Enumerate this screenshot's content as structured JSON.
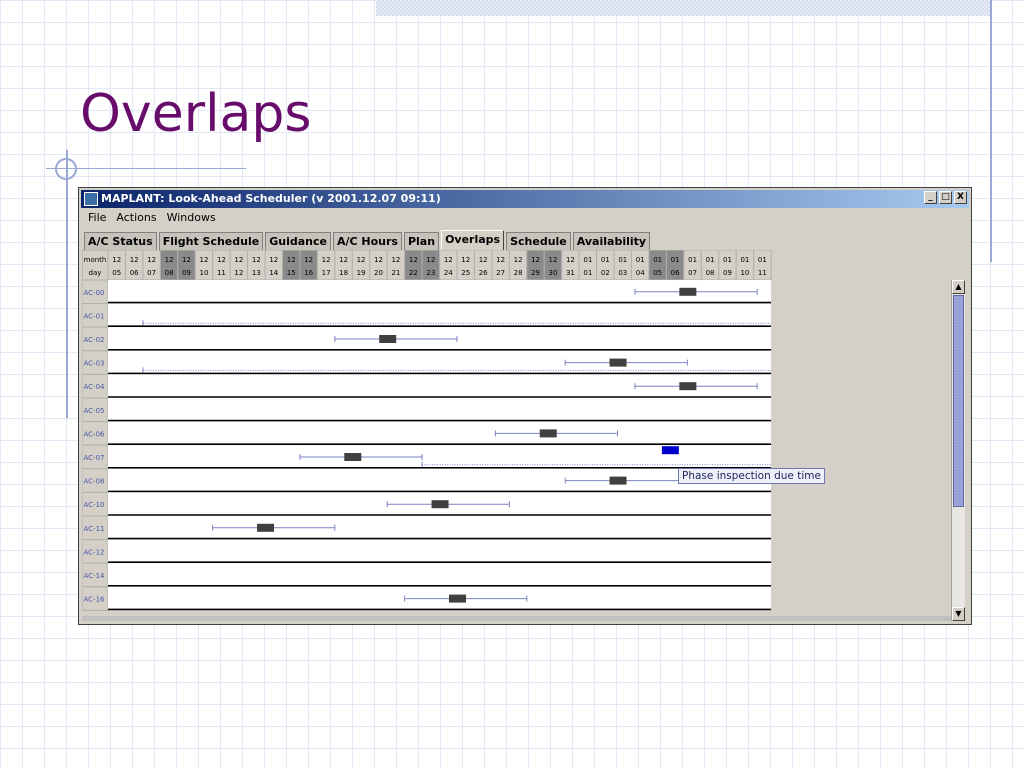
{
  "slide": {
    "title": "Overlaps"
  },
  "window": {
    "title": "MAPLANT: Look-Ahead Scheduler  (v 2001.12.07 09:11)",
    "controls": [
      "_",
      "□",
      "X"
    ]
  },
  "menu": [
    "File",
    "Actions",
    "Windows"
  ],
  "tabs": [
    {
      "label": "A/C Status",
      "active": false
    },
    {
      "label": "Flight Schedule",
      "active": false
    },
    {
      "label": "Guidance",
      "active": false
    },
    {
      "label": "A/C Hours",
      "active": false
    },
    {
      "label": "Plan",
      "active": false
    },
    {
      "label": "Overlaps",
      "active": true
    },
    {
      "label": "Schedule",
      "active": false
    },
    {
      "label": "Availability",
      "active": false
    }
  ],
  "grid": {
    "month_label": "month",
    "day_label": "day",
    "dates": [
      {
        "m": "12",
        "d": "05",
        "w": false
      },
      {
        "m": "12",
        "d": "06",
        "w": false
      },
      {
        "m": "12",
        "d": "07",
        "w": false
      },
      {
        "m": "12",
        "d": "08",
        "w": true
      },
      {
        "m": "12",
        "d": "09",
        "w": true
      },
      {
        "m": "12",
        "d": "10",
        "w": false
      },
      {
        "m": "12",
        "d": "11",
        "w": false
      },
      {
        "m": "12",
        "d": "12",
        "w": false
      },
      {
        "m": "12",
        "d": "13",
        "w": false
      },
      {
        "m": "12",
        "d": "14",
        "w": false
      },
      {
        "m": "12",
        "d": "15",
        "w": true
      },
      {
        "m": "12",
        "d": "16",
        "w": true
      },
      {
        "m": "12",
        "d": "17",
        "w": false
      },
      {
        "m": "12",
        "d": "18",
        "w": false
      },
      {
        "m": "12",
        "d": "19",
        "w": false
      },
      {
        "m": "12",
        "d": "20",
        "w": false
      },
      {
        "m": "12",
        "d": "21",
        "w": false
      },
      {
        "m": "12",
        "d": "22",
        "w": true
      },
      {
        "m": "12",
        "d": "23",
        "w": true
      },
      {
        "m": "12",
        "d": "24",
        "w": false
      },
      {
        "m": "12",
        "d": "25",
        "w": false
      },
      {
        "m": "12",
        "d": "26",
        "w": false
      },
      {
        "m": "12",
        "d": "27",
        "w": false
      },
      {
        "m": "12",
        "d": "28",
        "w": false
      },
      {
        "m": "12",
        "d": "29",
        "w": true
      },
      {
        "m": "12",
        "d": "30",
        "w": true
      },
      {
        "m": "12",
        "d": "31",
        "w": false
      },
      {
        "m": "01",
        "d": "01",
        "w": false
      },
      {
        "m": "01",
        "d": "02",
        "w": false
      },
      {
        "m": "01",
        "d": "03",
        "w": false
      },
      {
        "m": "01",
        "d": "04",
        "w": false
      },
      {
        "m": "01",
        "d": "05",
        "w": true
      },
      {
        "m": "01",
        "d": "06",
        "w": true
      },
      {
        "m": "01",
        "d": "07",
        "w": false
      },
      {
        "m": "01",
        "d": "08",
        "w": false
      },
      {
        "m": "01",
        "d": "09",
        "w": false
      },
      {
        "m": "01",
        "d": "10",
        "w": false
      },
      {
        "m": "01",
        "d": "11",
        "w": false
      }
    ]
  },
  "rows": [
    {
      "name": "AC-00",
      "items": [
        {
          "kind": "range",
          "start": 30.2,
          "end": 37.2
        },
        {
          "kind": "due",
          "at": 33.2
        }
      ]
    },
    {
      "name": "AC-01",
      "items": [
        {
          "kind": "dotted",
          "start": 2.0,
          "end": 38.0
        }
      ]
    },
    {
      "name": "AC-02",
      "items": [
        {
          "kind": "range",
          "start": 13.0,
          "end": 20.0
        },
        {
          "kind": "due",
          "at": 16.0
        }
      ]
    },
    {
      "name": "AC-03",
      "items": [
        {
          "kind": "dotted",
          "start": 2.0,
          "end": 38.0
        },
        {
          "kind": "range",
          "start": 26.2,
          "end": 33.2
        },
        {
          "kind": "due",
          "at": 29.2
        }
      ]
    },
    {
      "name": "AC-04",
      "items": [
        {
          "kind": "range",
          "start": 30.2,
          "end": 37.2
        },
        {
          "kind": "due",
          "at": 33.2
        }
      ]
    },
    {
      "name": "AC-05",
      "items": []
    },
    {
      "name": "AC-06",
      "items": [
        {
          "kind": "range",
          "start": 22.2,
          "end": 29.2
        },
        {
          "kind": "due",
          "at": 25.2
        }
      ]
    },
    {
      "name": "AC-07",
      "items": [
        {
          "kind": "dotted",
          "start": 18.0,
          "end": 38.0
        },
        {
          "kind": "range",
          "start": 11.0,
          "end": 18.0
        },
        {
          "kind": "due",
          "at": 14.0
        },
        {
          "kind": "selected",
          "at": 32.2
        }
      ]
    },
    {
      "name": "AC-08",
      "items": [
        {
          "kind": "range",
          "start": 26.2,
          "end": 33.2
        },
        {
          "kind": "due",
          "at": 29.2
        }
      ]
    },
    {
      "name": "AC-10",
      "items": [
        {
          "kind": "range",
          "start": 16.0,
          "end": 23.0
        },
        {
          "kind": "due",
          "at": 19.0
        }
      ]
    },
    {
      "name": "AC-11",
      "items": [
        {
          "kind": "range",
          "start": 6.0,
          "end": 13.0
        },
        {
          "kind": "due",
          "at": 9.0
        }
      ]
    },
    {
      "name": "AC-12",
      "items": []
    },
    {
      "name": "AC-14",
      "items": []
    },
    {
      "name": "AC-16",
      "items": [
        {
          "kind": "range",
          "start": 17.0,
          "end": 24.0
        },
        {
          "kind": "due",
          "at": 20.0
        }
      ]
    }
  ],
  "tooltip": {
    "text": "Phase inspection due time"
  },
  "colors": {
    "row_label": "#4a57a8",
    "range_line": "#7c84c4",
    "due_box": "#404040",
    "selected_box": "#0000cc",
    "weekend_cell": "#8a8a8a",
    "title": "#680c6b"
  },
  "icons": {
    "scroll_up": "arrow-up-icon",
    "scroll_down": "arrow-down-icon",
    "app": "app-icon"
  }
}
